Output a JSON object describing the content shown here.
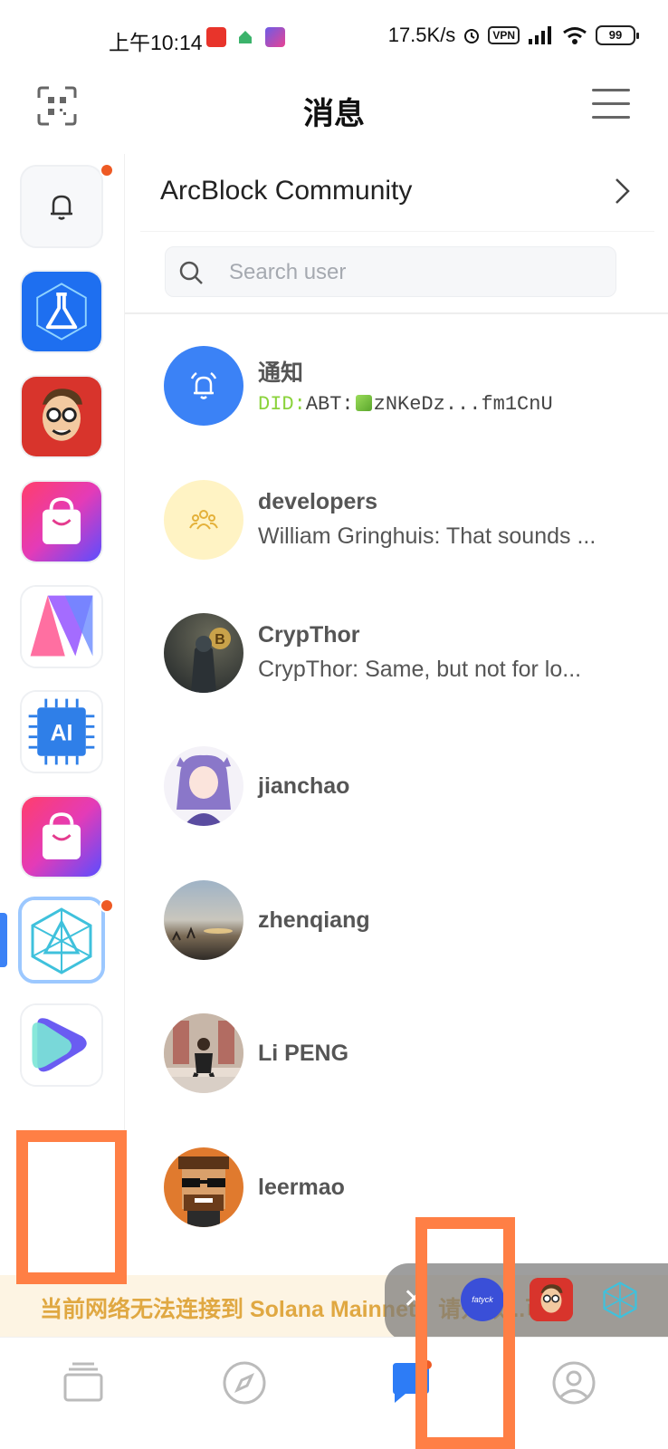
{
  "status_bar": {
    "time": "上午10:14",
    "net_speed": "17.5K/s",
    "vpn": "VPN",
    "battery": "99"
  },
  "header": {
    "title": "消息",
    "scan_icon": "qr-scan-icon",
    "menu_icon": "hamburger-menu-icon"
  },
  "sidebar": {
    "items": [
      {
        "name": "notification-bell",
        "icon": "bell-icon",
        "badge": true
      },
      {
        "name": "blocklet-lab",
        "icon": "flask-icon",
        "badge": false
      },
      {
        "name": "cartoon-avatar-app",
        "icon": "cartoon-face-icon",
        "badge": false
      },
      {
        "name": "store-app-1",
        "icon": "shopping-bag-icon",
        "badge": false
      },
      {
        "name": "n-app",
        "icon": "n-logo-icon",
        "badge": false
      },
      {
        "name": "ai-app",
        "icon": "ai-chip-icon",
        "badge": false
      },
      {
        "name": "store-app-2",
        "icon": "shopping-bag-icon",
        "badge": false
      },
      {
        "name": "arcblock-community",
        "icon": "arcblock-cube-icon",
        "badge": true,
        "active": true
      },
      {
        "name": "play-app",
        "icon": "play-logo-icon",
        "badge": false
      }
    ]
  },
  "community": {
    "name": "ArcBlock Community"
  },
  "search": {
    "placeholder": "Search user"
  },
  "chats": [
    {
      "name": "通知",
      "did_prefix": "DID:",
      "did_rest": "ABT:",
      "did_value": "zNKeDz...fm1CnU",
      "avatar": "alarm-bell-icon"
    },
    {
      "name": "developers",
      "message": "William Gringhuis: That sounds ...",
      "avatar": "group-icon"
    },
    {
      "name": "CrypThor",
      "message": "CrypThor: Same, but not for lo...",
      "avatar": "photo-avatar"
    },
    {
      "name": "jianchao",
      "message": "",
      "avatar": "photo-avatar"
    },
    {
      "name": "zhenqiang",
      "message": "",
      "avatar": "photo-avatar"
    },
    {
      "name": "Li PENG",
      "message": "",
      "avatar": "photo-avatar"
    },
    {
      "name": "leermao",
      "message": "",
      "avatar": "pixel-avatar"
    }
  ],
  "banner": {
    "text": "当前网络无法连接到 Solana Mainnet，请开数...可"
  },
  "floating_bar": {
    "app_label": "fatyck"
  },
  "tabbar": {
    "tabs": [
      {
        "name": "wallet",
        "icon": "cards-icon"
      },
      {
        "name": "discover",
        "icon": "compass-icon"
      },
      {
        "name": "messages",
        "icon": "chat-bubble-icon",
        "active": true
      },
      {
        "name": "profile",
        "icon": "user-circle-icon"
      }
    ]
  },
  "colors": {
    "accent": "#3b82f6",
    "badge": "#ee5a24",
    "banner_text": "#e0a842",
    "annotation": "#ff7f45"
  }
}
